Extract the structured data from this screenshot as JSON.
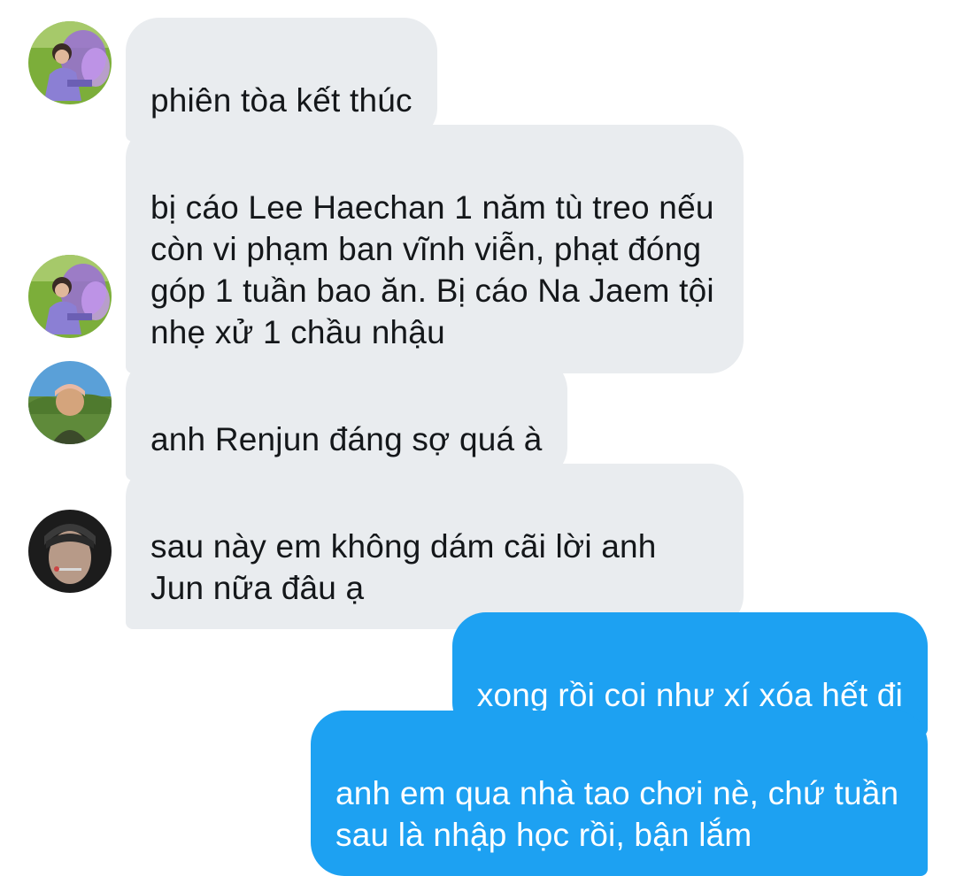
{
  "conversation": {
    "messages": [
      {
        "side": "incoming",
        "avatar": "avatar-fairy-wings",
        "text": "phiên tòa kết thúc"
      },
      {
        "side": "incoming",
        "avatar": "avatar-fairy-wings",
        "text": "bị cáo Lee Haechan 1 năm tù treo nếu còn vi phạm ban vĩnh viễn, phạt đóng góp 1 tuần bao ăn. Bị cáo Na Jaem tội nhẹ xử 1 chầu nhậu"
      },
      {
        "side": "incoming",
        "avatar": "avatar-landscape",
        "text": "anh Renjun đáng sợ quá à"
      },
      {
        "side": "incoming",
        "avatar": "avatar-portrait-dark",
        "text": "sau này em không dám cãi lời anh Jun nữa đâu ạ"
      },
      {
        "side": "outgoing",
        "text": "xong rồi coi như xí xóa hết đi"
      },
      {
        "side": "outgoing",
        "text": "anh em qua nhà tao chơi nè, chứ tuần sau là nhập học rồi, bận lắm"
      }
    ]
  },
  "colors": {
    "incoming_bubble": "#e9ecef",
    "incoming_text": "#14171a",
    "outgoing_bubble": "#1da1f2",
    "outgoing_text": "#ffffff",
    "background": "#ffffff"
  }
}
